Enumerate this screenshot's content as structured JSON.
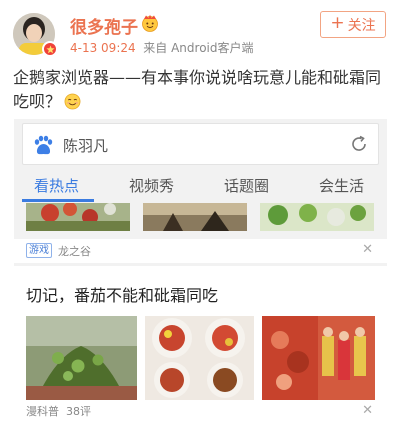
{
  "post": {
    "username": "很多孢子",
    "time": "4-13 09:24",
    "source": "来自 Android客户端",
    "follow_label": "关注",
    "text": "企鹅家浏览器——有本事你说说啥玩意儿能和砒霜同吃呗？"
  },
  "embed": {
    "search_text": "陈羽凡",
    "tabs": [
      "看热点",
      "视频秀",
      "话题圈",
      "会生活"
    ],
    "active_tab": 0,
    "strip_item": {
      "tag": "游戏",
      "source": "龙之谷"
    },
    "article": {
      "title": "切记，番茄不能和砒霜同吃",
      "source": "漫科普",
      "comments": "38评"
    }
  },
  "colors": {
    "username": "#eb7350",
    "tab_active": "#3a7be0",
    "card_bg": "#f2f2f2"
  },
  "icons": [
    "verified-badge-icon",
    "crown-emoji-icon",
    "smile-emoji-icon",
    "baidu-paw-icon",
    "refresh-icon",
    "close-icon"
  ]
}
